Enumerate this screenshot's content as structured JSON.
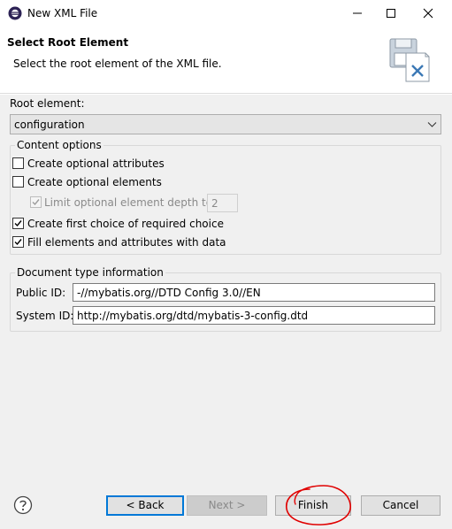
{
  "window": {
    "title": "New XML File",
    "icon": "eclipse-icon"
  },
  "banner": {
    "title": "Select Root Element",
    "subtitle": "Select the root element of the XML file.",
    "image": "xml-file-wizard-icon"
  },
  "root_element": {
    "label": "Root element:",
    "value": "configuration"
  },
  "content_options": {
    "legend": "Content options",
    "items": [
      {
        "label": "Create optional attributes",
        "checked": false,
        "enabled": true
      },
      {
        "label": "Create optional elements",
        "checked": false,
        "enabled": true
      },
      {
        "label": "Limit optional element depth to:",
        "checked": true,
        "enabled": false
      },
      {
        "label": "Create first choice of required choice",
        "checked": true,
        "enabled": true
      },
      {
        "label": "Fill elements and attributes with data",
        "checked": true,
        "enabled": true
      }
    ],
    "depth_value": "2"
  },
  "doctype": {
    "legend": "Document type information",
    "public_id_label": "Public ID:",
    "public_id": "-//mybatis.org//DTD Config 3.0//EN",
    "system_id_label": "System ID:",
    "system_id": "http://mybatis.org/dtd/mybatis-3-config.dtd"
  },
  "buttons": {
    "back": "< Back",
    "next": "Next >",
    "finish": "Finish",
    "cancel": "Cancel"
  },
  "colors": {
    "accent": "#0078d7",
    "annotation": "#e00000"
  }
}
